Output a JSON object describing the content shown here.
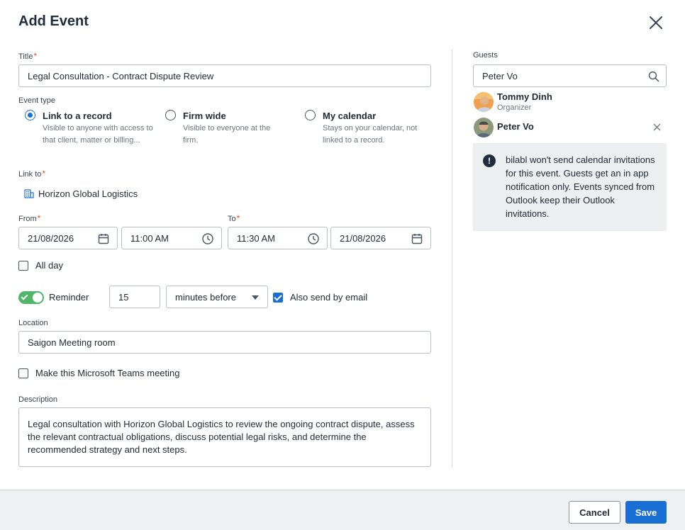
{
  "dialog": {
    "title": "Add Event",
    "close_icon": "close-icon"
  },
  "title_field": {
    "label": "Title",
    "required_mark": "*",
    "value": "Legal Consultation - Contract Dispute Review"
  },
  "event_type": {
    "label": "Event type",
    "options": [
      {
        "title": "Link to a record",
        "desc": "Visible to anyone with access to that client, matter or billing...",
        "selected": true
      },
      {
        "title": "Firm wide",
        "desc": "Visible to everyone at the firm.",
        "selected": false
      },
      {
        "title": "My calendar",
        "desc": "Stays on your calendar, not linked to a record.",
        "selected": false
      }
    ]
  },
  "link_to": {
    "label": "Link to",
    "required_mark": "*",
    "value": "Horizon Global Logistics",
    "icon": "building-icon"
  },
  "from": {
    "label": "From",
    "required_mark": "*",
    "date": "21/08/2026",
    "time": "11:00 AM"
  },
  "to": {
    "label": "To",
    "required_mark": "*",
    "time": "11:30 AM",
    "date": "21/08/2026"
  },
  "all_day": {
    "label": "All day",
    "checked": false
  },
  "reminder": {
    "label": "Reminder",
    "enabled": true,
    "amount": "15",
    "unit": "minutes before",
    "email_label": "Also send by email",
    "email_checked": true
  },
  "location": {
    "label": "Location",
    "value": "Saigon Meeting room"
  },
  "teams": {
    "label": "Make this Microsoft Teams meeting",
    "checked": false
  },
  "description": {
    "label": "Description",
    "value": "Legal consultation with Horizon Global Logistics to review the ongoing contract dispute, assess the relevant contractual obligations, discuss potential legal risks, and determine the recommended strategy and next steps."
  },
  "guests": {
    "label": "Guests",
    "search_value": "Peter Vo",
    "list": [
      {
        "name": "Tommy Dinh",
        "role": "Organizer"
      },
      {
        "name": "Peter Vo",
        "role": ""
      }
    ],
    "notice": "bilabl won't send calendar invitations for this event. Guests get an in app notification only. Events synced from Outlook keep their Outlook invitations."
  },
  "footer": {
    "cancel_label": "Cancel",
    "save_label": "Save"
  },
  "colors": {
    "accent": "#1a6fd4",
    "required": "#e0531f",
    "toggle_on": "#4fb66a"
  }
}
